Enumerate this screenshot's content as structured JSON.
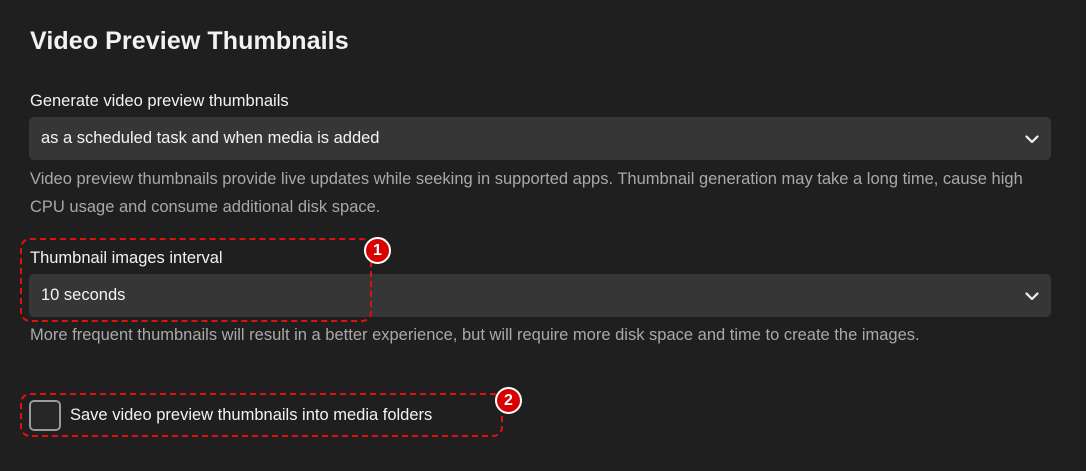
{
  "section": {
    "title": "Video Preview Thumbnails"
  },
  "generate": {
    "label": "Generate video preview thumbnails",
    "selected": "as a scheduled task and when media is added",
    "help": "Video preview thumbnails provide live updates while seeking in supported apps. Thumbnail generation may take a long time, cause high CPU usage and consume additional disk space."
  },
  "interval": {
    "label": "Thumbnail images interval",
    "selected": "10 seconds",
    "help": "More frequent thumbnails will result in a better experience, but will require more disk space and time to create the images."
  },
  "save_option": {
    "label": "Save video preview thumbnails into media folders",
    "checked": false
  },
  "annotations": [
    {
      "number": "1"
    },
    {
      "number": "2"
    }
  ],
  "colors": {
    "background": "#1f1f1f",
    "select_bg": "#363636",
    "help_text": "#a9a9a9",
    "annotation": "#e01010"
  },
  "icons": [
    "chevron-down-icon"
  ]
}
